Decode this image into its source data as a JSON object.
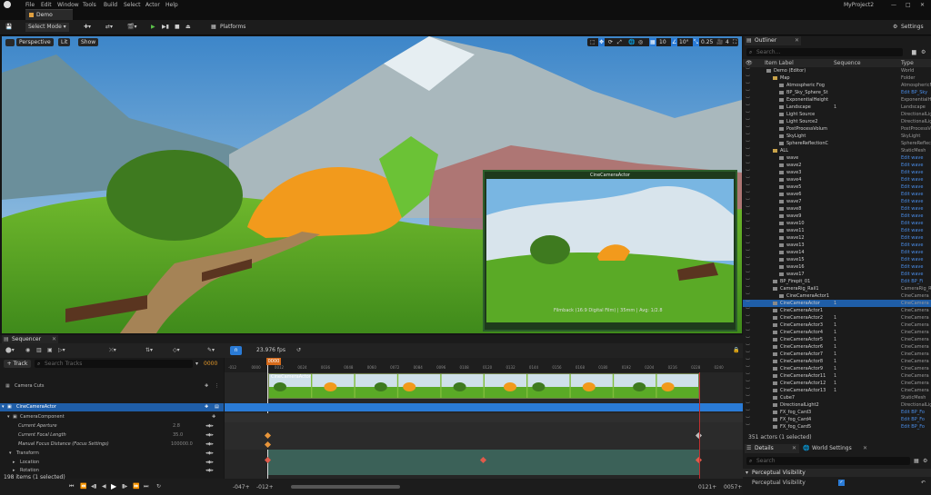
{
  "menu": [
    "File",
    "Edit",
    "Window",
    "Tools",
    "Build",
    "Select",
    "Actor",
    "Help"
  ],
  "project_name": "MyProject2",
  "tab": "Demo",
  "toolbar": {
    "select_mode": "Select Mode",
    "platforms": "Platforms",
    "settings": "Settings"
  },
  "viewport": {
    "perspective": "Perspective",
    "lit": "Lit",
    "show": "Show",
    "grid": "10",
    "angle": "10°",
    "scale": "0.25",
    "cam": "4",
    "pip_title": "CineCameraActor",
    "pip_caption": "Filmback (16:9 Digital Film) | 35mm | Avg: 1/2.8"
  },
  "sequencer": {
    "title": "Sequencer",
    "track": "+ Track",
    "search_placeholder": "Search Tracks",
    "frame": "0000",
    "fps": "23.976 fps",
    "playhead": "0000",
    "ticks": [
      "-012",
      "0000",
      "0012",
      "0024",
      "0036",
      "0048",
      "0060",
      "0072",
      "0084",
      "0096",
      "0108",
      "0120",
      "0132",
      "0144",
      "0156",
      "0168",
      "0180",
      "0192",
      "0204",
      "0216",
      "0228",
      "0240"
    ],
    "tracks": [
      {
        "label": "Camera Cuts"
      },
      {
        "label": "CineCameraActor"
      },
      {
        "label": "CameraComponent"
      },
      {
        "label": "Current Aperture",
        "val": "2.8"
      },
      {
        "label": "Current Focal Length",
        "val": "35.0"
      },
      {
        "label": "Manual Focus Distance (Focus Settings)",
        "val": "100000.0"
      },
      {
        "label": "Transform"
      },
      {
        "label": "Location"
      },
      {
        "label": "Rotation"
      }
    ],
    "items": "198 items (1 selected)",
    "start": "-047+",
    "start2": "-012+",
    "end": "0121+",
    "end2": "0057+",
    "shot": "CineCameraActor"
  },
  "outliner": {
    "title": "Outliner",
    "search_placeholder": "Search...",
    "col_label": "Item Label",
    "col_seq": "Sequence",
    "col_type": "Type",
    "footer": "351 actors (1 selected)",
    "rows": [
      {
        "l": "Demo (Editor)",
        "s": "",
        "t": "World",
        "d": 0
      },
      {
        "l": "Map",
        "s": "",
        "t": "Folder",
        "d": 1
      },
      {
        "l": "Atmospheric Fog",
        "s": "",
        "t": "AtmosphericFog",
        "d": 2
      },
      {
        "l": "BP_Sky_Sphere_St",
        "s": "",
        "t": "Edit BP_Sky",
        "d": 2,
        "k": 1
      },
      {
        "l": "ExponentialHeight",
        "s": "",
        "t": "ExponentialHeight",
        "d": 2
      },
      {
        "l": "Landscape",
        "s": "1",
        "t": "Landscape",
        "d": 2
      },
      {
        "l": "Light Source",
        "s": "",
        "t": "DirectionalLight",
        "d": 2
      },
      {
        "l": "Light Source2",
        "s": "",
        "t": "DirectionalLight",
        "d": 2
      },
      {
        "l": "PostProcessVolum",
        "s": "",
        "t": "PostProcessVolume",
        "d": 2
      },
      {
        "l": "SkyLight",
        "s": "",
        "t": "SkyLight",
        "d": 2
      },
      {
        "l": "SphereReflectionC",
        "s": "",
        "t": "SphereReflection",
        "d": 2
      },
      {
        "l": "ALL",
        "s": "",
        "t": "StaticMesh",
        "d": 1
      },
      {
        "l": "wave",
        "s": "",
        "t": "Edit wave",
        "d": 2,
        "k": 1
      },
      {
        "l": "wave2",
        "s": "",
        "t": "Edit wave",
        "d": 2,
        "k": 1
      },
      {
        "l": "wave3",
        "s": "",
        "t": "Edit wave",
        "d": 2,
        "k": 1
      },
      {
        "l": "wave4",
        "s": "",
        "t": "Edit wave",
        "d": 2,
        "k": 1
      },
      {
        "l": "wave5",
        "s": "",
        "t": "Edit wave",
        "d": 2,
        "k": 1
      },
      {
        "l": "wave6",
        "s": "",
        "t": "Edit wave",
        "d": 2,
        "k": 1
      },
      {
        "l": "wave7",
        "s": "",
        "t": "Edit wave",
        "d": 2,
        "k": 1
      },
      {
        "l": "wave8",
        "s": "",
        "t": "Edit wave",
        "d": 2,
        "k": 1
      },
      {
        "l": "wave9",
        "s": "",
        "t": "Edit wave",
        "d": 2,
        "k": 1
      },
      {
        "l": "wave10",
        "s": "",
        "t": "Edit wave",
        "d": 2,
        "k": 1
      },
      {
        "l": "wave11",
        "s": "",
        "t": "Edit wave",
        "d": 2,
        "k": 1
      },
      {
        "l": "wave12",
        "s": "",
        "t": "Edit wave",
        "d": 2,
        "k": 1
      },
      {
        "l": "wave13",
        "s": "",
        "t": "Edit wave",
        "d": 2,
        "k": 1
      },
      {
        "l": "wave14",
        "s": "",
        "t": "Edit wave",
        "d": 2,
        "k": 1
      },
      {
        "l": "wave15",
        "s": "",
        "t": "Edit wave",
        "d": 2,
        "k": 1
      },
      {
        "l": "wave16",
        "s": "",
        "t": "Edit wave",
        "d": 2,
        "k": 1
      },
      {
        "l": "wave17",
        "s": "",
        "t": "Edit wave",
        "d": 2,
        "k": 1
      },
      {
        "l": "BP_Firepit_01",
        "s": "",
        "t": "Edit BP_Fi",
        "d": 1,
        "k": 1
      },
      {
        "l": "CameraRig_Rail1",
        "s": "",
        "t": "CameraRig_Rail",
        "d": 1
      },
      {
        "l": "CineCameraActor1",
        "s": "",
        "t": "CineCamera",
        "d": 2
      },
      {
        "l": "CineCameraActor",
        "s": "1",
        "t": "CineCamera",
        "d": 1,
        "sel": 1
      },
      {
        "l": "CineCameraActor1",
        "s": "",
        "t": "CineCamera",
        "d": 1
      },
      {
        "l": "CineCameraActor2",
        "s": "1",
        "t": "CineCamera",
        "d": 1
      },
      {
        "l": "CineCameraActor3",
        "s": "1",
        "t": "CineCamera",
        "d": 1
      },
      {
        "l": "CineCameraActor4",
        "s": "1",
        "t": "CineCamera",
        "d": 1
      },
      {
        "l": "CineCameraActor5",
        "s": "1",
        "t": "CineCamera",
        "d": 1
      },
      {
        "l": "CineCameraActor6",
        "s": "1",
        "t": "CineCamera",
        "d": 1
      },
      {
        "l": "CineCameraActor7",
        "s": "1",
        "t": "CineCamera",
        "d": 1
      },
      {
        "l": "CineCameraActor8",
        "s": "1",
        "t": "CineCamera",
        "d": 1
      },
      {
        "l": "CineCameraActor9",
        "s": "1",
        "t": "CineCamera",
        "d": 1
      },
      {
        "l": "CineCameraActor11",
        "s": "1",
        "t": "CineCamera",
        "d": 1
      },
      {
        "l": "CineCameraActor12",
        "s": "1",
        "t": "CineCamera",
        "d": 1
      },
      {
        "l": "CineCameraActor13",
        "s": "1",
        "t": "CineCamera",
        "d": 1
      },
      {
        "l": "Cube7",
        "s": "",
        "t": "StaticMesh",
        "d": 1
      },
      {
        "l": "DirectionalLight2",
        "s": "",
        "t": "DirectionalLight",
        "d": 1
      },
      {
        "l": "FX_fog_Card3",
        "s": "",
        "t": "Edit BP_Fo",
        "d": 1,
        "k": 1
      },
      {
        "l": "FX_fog_Card4",
        "s": "",
        "t": "Edit BP_Fo",
        "d": 1,
        "k": 1
      },
      {
        "l": "FX_fog_Card5",
        "s": "",
        "t": "Edit BP_Fo",
        "d": 1,
        "k": 1
      }
    ]
  },
  "details": {
    "title": "Details",
    "world_settings": "World Settings",
    "search_placeholder": "Search",
    "section": "Perceptual Visibility",
    "prop": "Perceptual Visibility"
  },
  "colors": {
    "accent": "#2a7bd6",
    "selection": "#1f5ea8",
    "link": "#4a8de8"
  }
}
